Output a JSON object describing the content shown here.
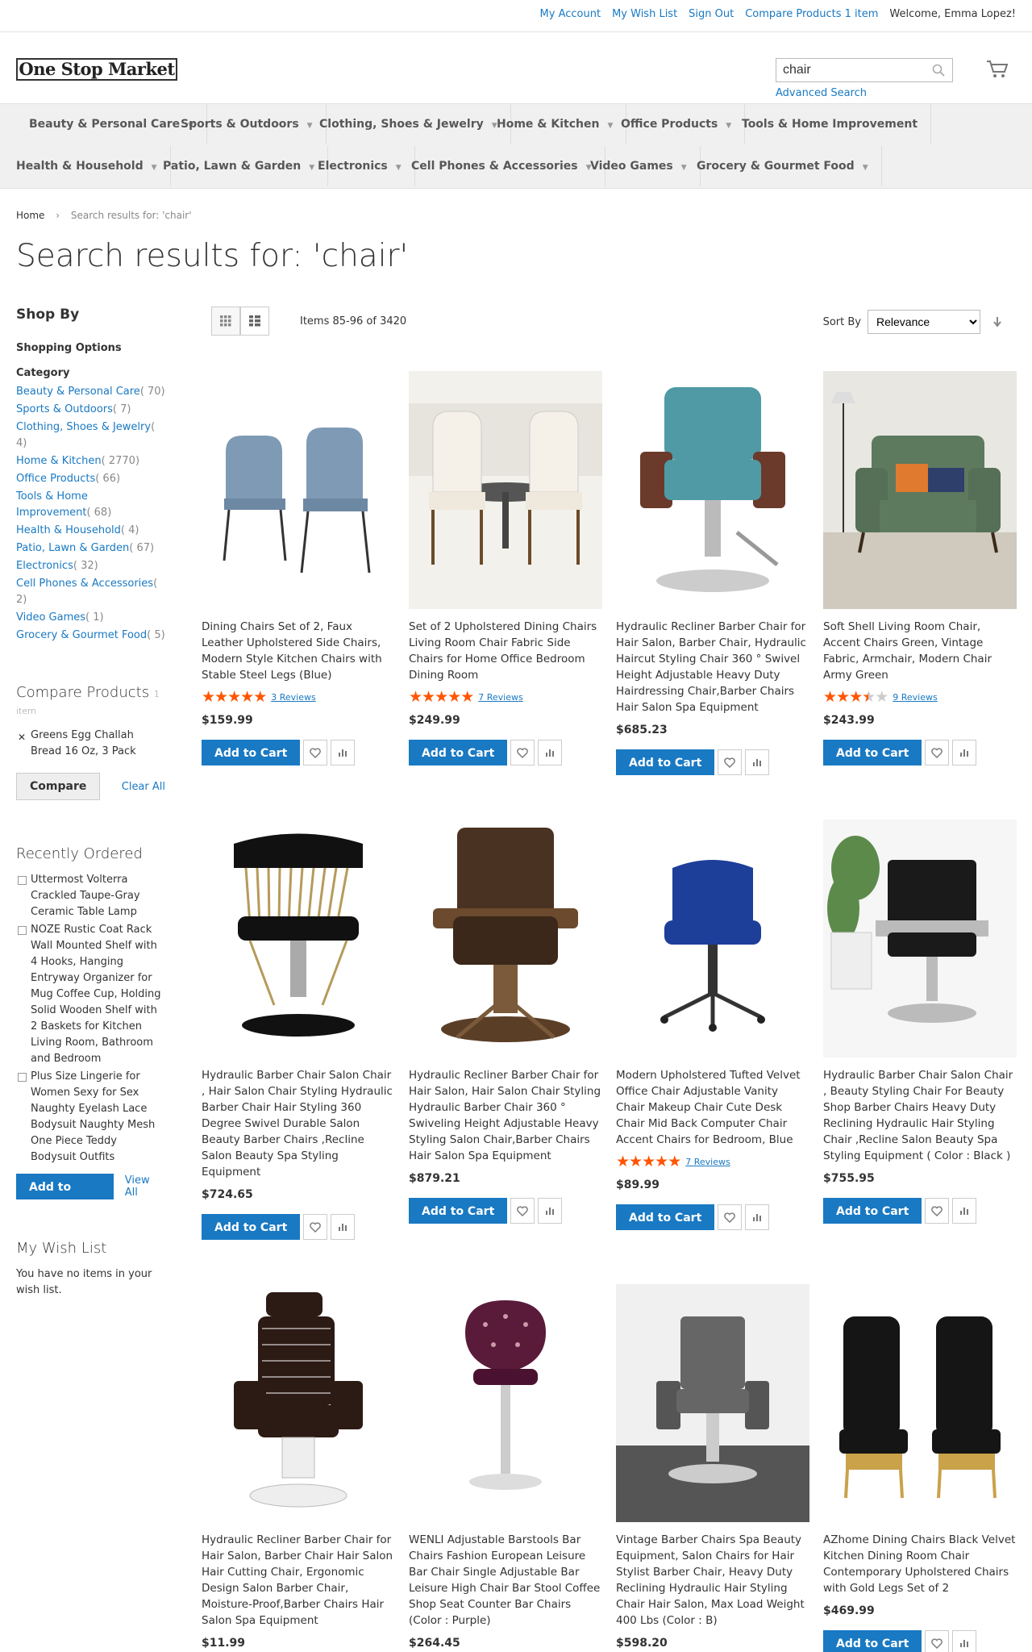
{
  "header": {
    "links": [
      "My Account",
      "My Wish List",
      "Sign Out",
      "Compare Products 1 item"
    ],
    "welcome": "Welcome, Emma Lopez!",
    "logo": "One Stop Market",
    "search_value": "chair",
    "advanced_search": "Advanced Search"
  },
  "nav": {
    "row1": [
      "Beauty & Personal Care",
      "Sports & Outdoors",
      "Clothing, Shoes & Jewelry",
      "Home & Kitchen",
      "Office Products",
      "Tools & Home Improvement"
    ],
    "row2": [
      "Health & Household",
      "Patio, Lawn & Garden",
      "Electronics",
      "Cell Phones & Accessories",
      "Video Games",
      "Grocery & Gourmet Food"
    ]
  },
  "breadcrumb": {
    "home": "Home",
    "current": "Search results for: 'chair'"
  },
  "page_title": "Search results for: 'chair'",
  "sidebar": {
    "shop_by": "Shop By",
    "shopping_options": "Shopping Options",
    "category_title": "Category",
    "categories": [
      {
        "name": "Beauty & Personal Care",
        "count": "( 70)"
      },
      {
        "name": "Sports & Outdoors",
        "count": "( 7)"
      },
      {
        "name": "Clothing, Shoes & Jewelry",
        "count": "( 4)"
      },
      {
        "name": "Home & Kitchen",
        "count": "( 2770)"
      },
      {
        "name": "Office Products",
        "count": "( 66)"
      },
      {
        "name": "Tools & Home Improvement",
        "count": "( 68)"
      },
      {
        "name": "Health & Household",
        "count": "( 4)"
      },
      {
        "name": "Patio, Lawn & Garden",
        "count": "( 67)"
      },
      {
        "name": "Electronics",
        "count": "( 32)"
      },
      {
        "name": "Cell Phones & Accessories",
        "count": "( 2)"
      },
      {
        "name": "Video Games",
        "count": "( 1)"
      },
      {
        "name": "Grocery & Gourmet Food",
        "count": "( 5)"
      }
    ],
    "compare_title": "Compare Products",
    "compare_count": "1 item",
    "compare_item": "Greens Egg Challah Bread 16 Oz, 3 Pack",
    "compare_button": "Compare",
    "clear_all": "Clear All",
    "recent_title": "Recently Ordered",
    "recent_items": [
      "Uttermost Volterra Crackled Taupe-Gray Ceramic Table Lamp",
      "NOZE Rustic Coat Rack Wall Mounted Shelf with 4 Hooks, Hanging Entryway Organizer for Mug Coffee Cup, Holding Solid Wooden Shelf with 2 Baskets for Kitchen Living Room, Bathroom and Bedroom",
      "Plus Size Lingerie for Women Sexy for Sex Naughty Eyelash Lace Bodysuit Naughty Mesh One Piece Teddy Bodysuit Outfits"
    ],
    "add_to_cart": "Add to Cart",
    "view_all": "View All",
    "wishlist_title": "My Wish List",
    "wishlist_empty": "You have no items in your wish list."
  },
  "toolbar": {
    "amount": "Items 85-96 of 3420",
    "sort_label": "Sort By",
    "sort_value": "Relevance"
  },
  "products": [
    {
      "name": "Dining Chairs Set of 2, Faux Leather Upholstered Side Chairs, Modern Style Kitchen Chairs with Stable Steel Legs (Blue)",
      "rating": 5,
      "reviews": "3  Reviews",
      "price": "$159.99",
      "img": "blue-chairs"
    },
    {
      "name": "Set of 2 Upholstered Dining Chairs Living Room Chair Fabric Side Chairs for Home Office Bedroom Dining Room",
      "rating": 5,
      "reviews": "7  Reviews",
      "price": "$249.99",
      "img": "white-dining"
    },
    {
      "name": "Hydraulic Recliner Barber Chair for Hair Salon, Barber Chair, Hydraulic Haircut Styling Chair 360 ° Swivel Height Adjustable Heavy Duty Hairdressing Chair,Barber Chairs Hair Salon Spa Equipment",
      "rating": 0,
      "reviews": "",
      "price": "$685.23",
      "img": "teal-barber"
    },
    {
      "name": "Soft Shell Living Room Chair, Accent Chairs Green, Vintage Fabric, Armchair, Modern Chair Army Green",
      "rating": 3.5,
      "reviews": "9  Reviews",
      "price": "$243.99",
      "img": "green-armchair"
    },
    {
      "name": "Hydraulic Barber Chair Salon Chair , Hair Salon Chair Styling Hydraulic Barber Chair Hair Styling 360 Degree Swivel Durable Salon Beauty Barber Chairs ,Recline Salon Beauty Spa Styling Equipment",
      "rating": 0,
      "reviews": "",
      "price": "$724.65",
      "img": "black-gold-barber"
    },
    {
      "name": "Hydraulic Recliner Barber Chair for Hair Salon, Hair Salon Chair Styling Hydraulic Barber Chair 360 ° Swiveling Height Adjustable Heavy Styling Salon Chair,Barber Chairs Hair Salon Spa Equipment",
      "rating": 0,
      "reviews": "",
      "price": "$879.21",
      "img": "brown-barber"
    },
    {
      "name": "Modern Upholstered Tufted Velvet Office Chair Adjustable Vanity Chair Makeup Chair Cute Desk Chair Mid Back Computer Chair Accent Chairs for Bedroom, Blue",
      "rating": 5,
      "reviews": "7  Reviews",
      "price": "$89.99",
      "img": "blue-office"
    },
    {
      "name": "Hydraulic Barber Chair Salon Chair , Beauty Styling Chair For Beauty Shop Barber Chairs Heavy Duty Reclining Hydraulic Hair Styling Chair ,Recline Salon Beauty Spa Styling Equipment ( Color : Black )",
      "rating": 0,
      "reviews": "",
      "price": "$755.95",
      "img": "black-salon"
    },
    {
      "name": "Hydraulic Recliner Barber Chair for Hair Salon, Barber Chair Hair Salon Hair Cutting Chair, Ergonomic Design Salon Barber Chair, Moisture-Proof,Barber Chairs Hair Salon Spa Equipment",
      "rating": 0,
      "reviews": "",
      "price": "$11.99",
      "img": "white-barber"
    },
    {
      "name": "WENLI Adjustable Barstools Bar Chairs Fashion European Leisure Bar Chair Single Adjustable Bar Leisure High Chair Bar Stool Coffee Shop Seat Counter Bar Chairs (Color : Purple)",
      "rating": 0,
      "reviews": "",
      "price": "$264.45",
      "img": "purple-stool"
    },
    {
      "name": "Vintage Barber Chairs Spa Beauty Equipment, Salon Chairs for Hair Stylist Barber Chair, Heavy Duty Reclining Hydraulic Hair Styling Chair Hair Salon, Max Load Weight 400 Lbs (Color : B)",
      "rating": 0,
      "reviews": "",
      "price": "$598.20",
      "img": "gray-salon"
    },
    {
      "name": "AZhome Dining Chairs Black Velvet Kitchen Dining Room Chair Contemporary Upholstered Chairs with Gold Legs Set of 2",
      "rating": 0,
      "reviews": "",
      "price": "$469.99",
      "img": "black-velvet"
    }
  ],
  "colors": {
    "link": "#1979c3",
    "star": "#ff5501",
    "button": "#1979c3"
  }
}
